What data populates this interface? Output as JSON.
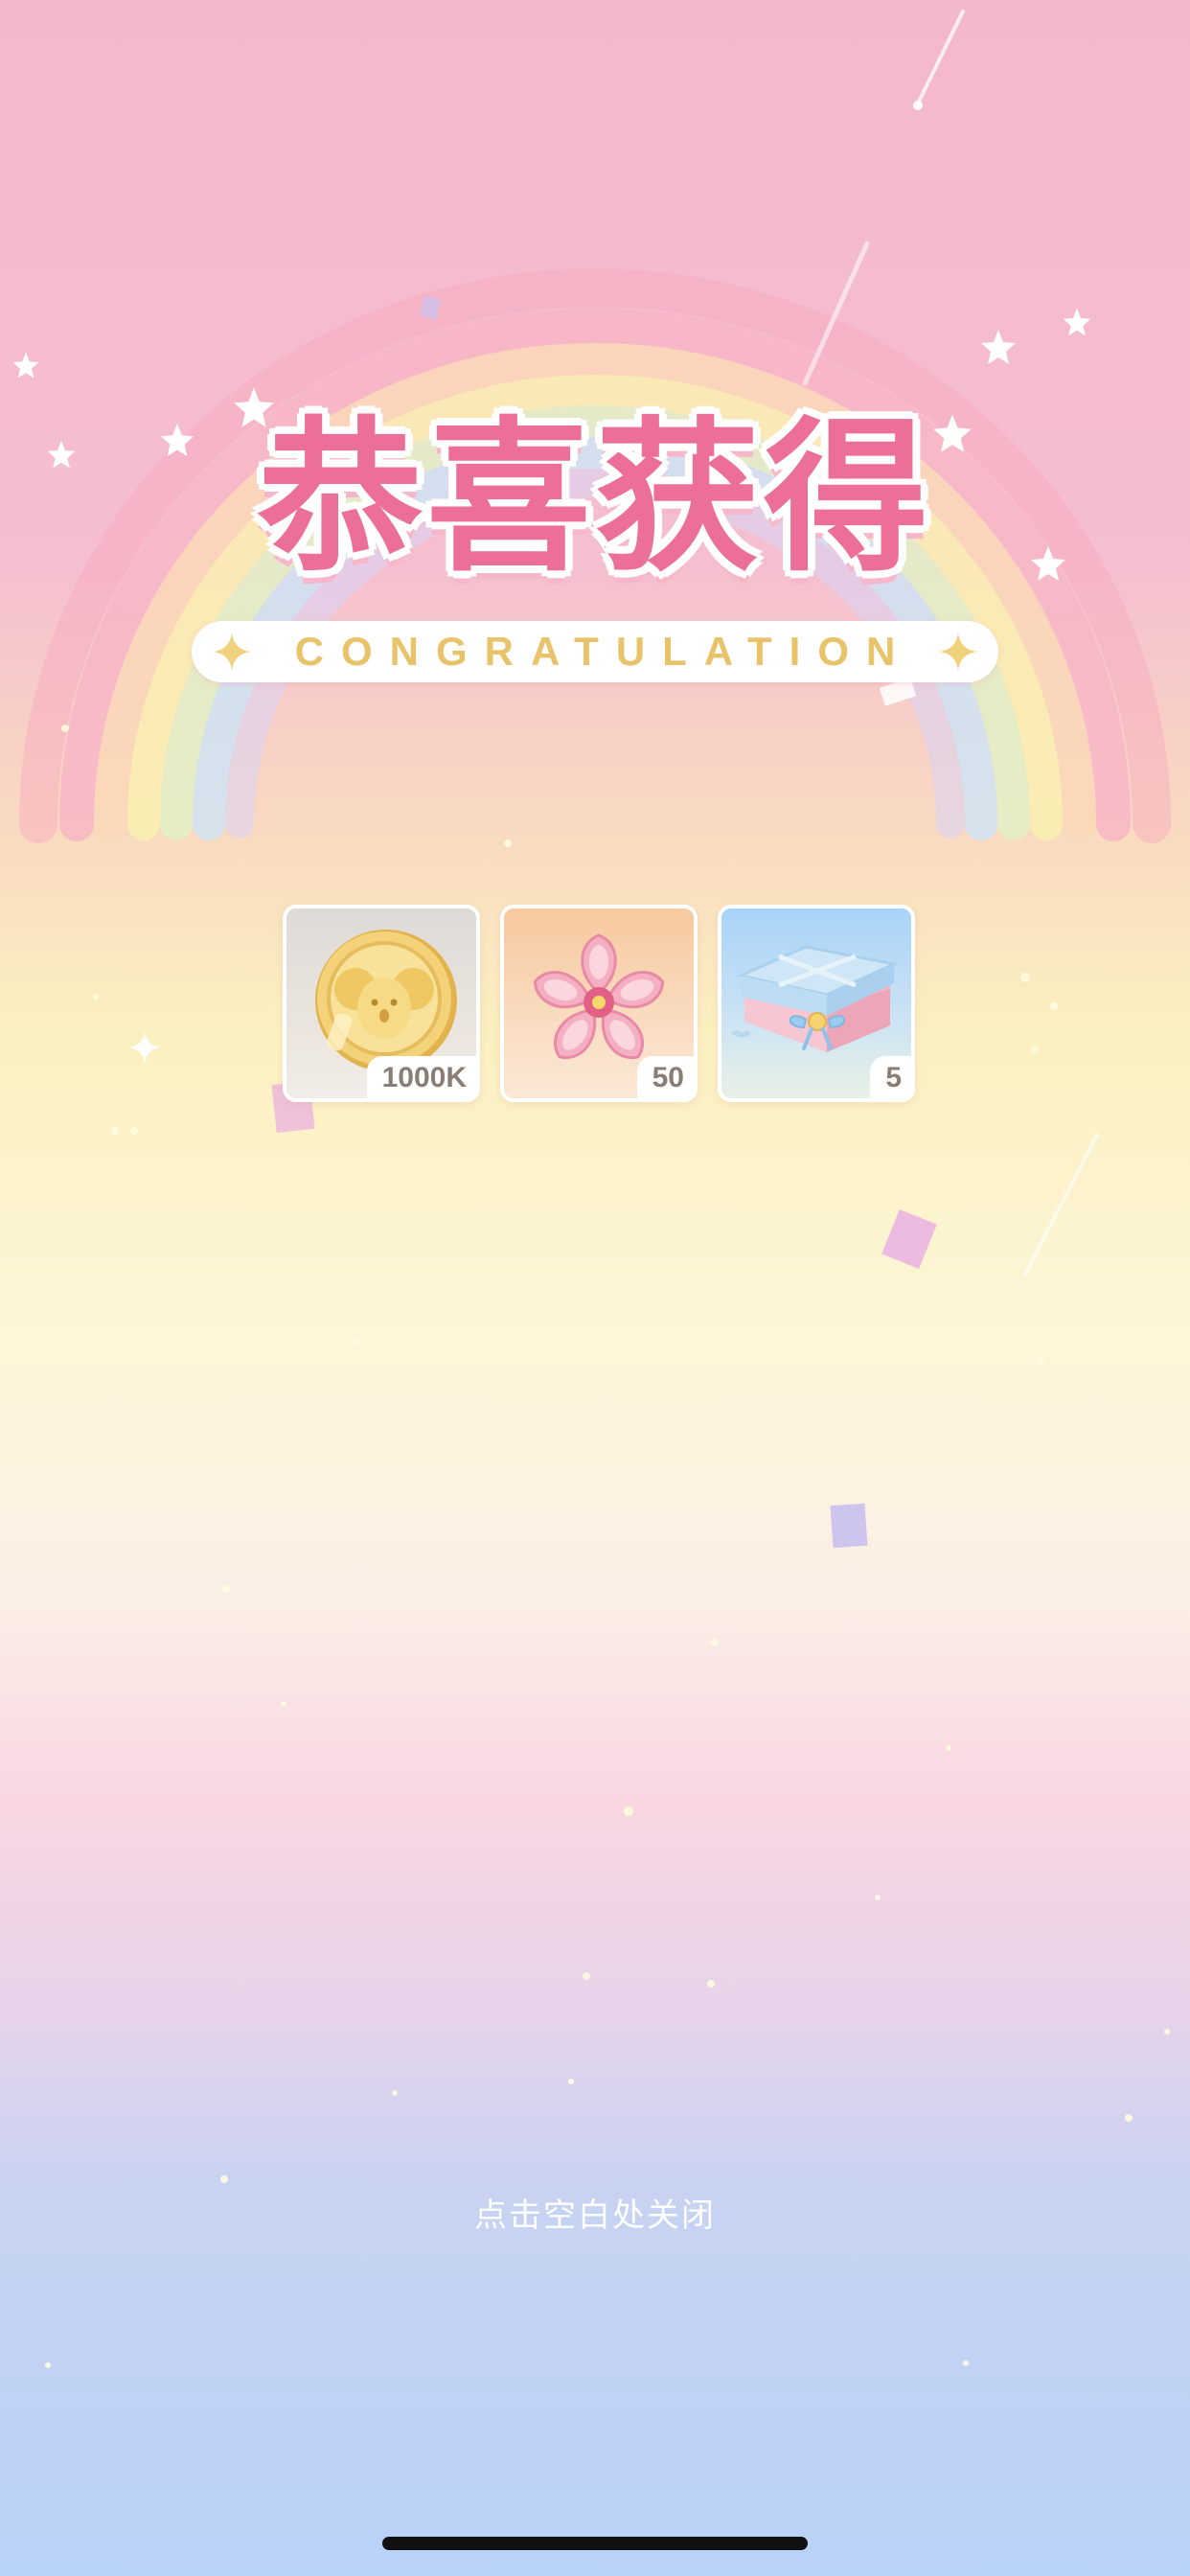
{
  "title": "恭喜获得",
  "subtitle": "CONGRATULATION",
  "rewards": [
    {
      "icon": "gold-coin-icon",
      "count": "1000K"
    },
    {
      "icon": "sakura-flower-icon",
      "count": "50"
    },
    {
      "icon": "gift-box-icon",
      "count": "5"
    }
  ],
  "close_hint": "点击空白处关闭",
  "colors": {
    "title": "#ec6f98",
    "subtitle": "#e8c36a",
    "count_text": "#8a7d73"
  }
}
